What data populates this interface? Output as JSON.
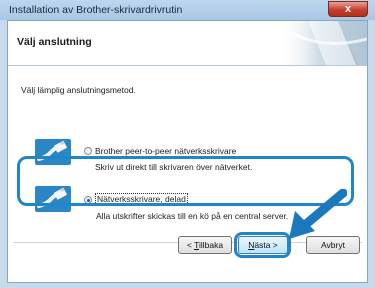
{
  "window": {
    "title": "Installation av Brother-skrivardrivrutin",
    "close_glyph": "x"
  },
  "header": {
    "title": "Välj anslutning"
  },
  "content": {
    "instruction": "Välj lämplig anslutningsmetod."
  },
  "options": [
    {
      "label": "Brother peer-to-peer nätverksskrivare",
      "description": "Skriv ut direkt till skrivaren över nätverket.",
      "selected": false,
      "icon": "network-cable-icon"
    },
    {
      "label": "Nätverksskrivare, delad",
      "description": "Alla utskrifter skickas till en kö på en central server.",
      "selected": true,
      "icon": "network-cable-icon"
    }
  ],
  "buttons": {
    "back_key": "T",
    "back_rest": "illbaka",
    "back_prefix": "< ",
    "next_key": "N",
    "next_rest": "ästa >",
    "cancel": "Avbryt"
  },
  "colors": {
    "highlight": "#1f86c7",
    "arrow": "#1b78bd"
  }
}
